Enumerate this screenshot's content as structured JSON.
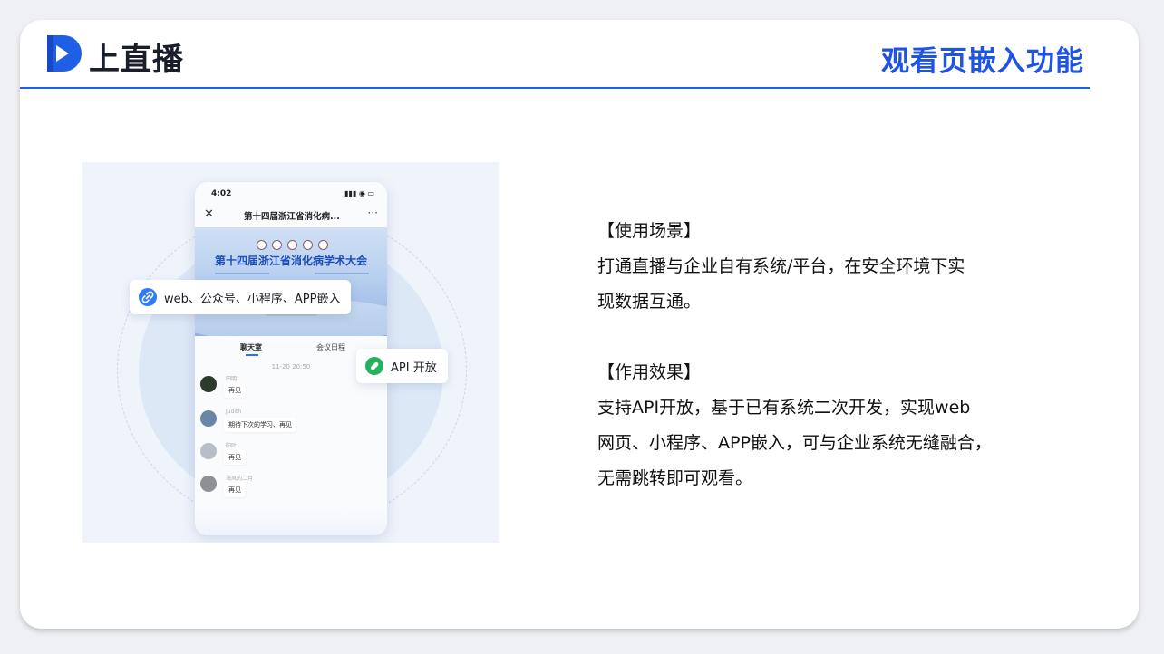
{
  "header": {
    "logo_text": "上直播",
    "page_title": "观看页嵌入功能"
  },
  "colors": {
    "accent": "#1f53e6",
    "rule": "#1f5ee8",
    "pill_blue": "#2f7cf6",
    "pill_green": "#22b35e"
  },
  "phone": {
    "time": "4:02",
    "status_icons": "▮▮▮ ◉ ▭",
    "nav_close": "✕",
    "nav_title": "第十四届浙江省消化病...",
    "nav_more": "···",
    "banner_title": "第十四届浙江省消化病学术大会",
    "tabs": [
      "聊天室",
      "会议日程"
    ],
    "chat_time": "11-20 20:50",
    "messages": [
      {
        "name": "田明",
        "text": "再见"
      },
      {
        "name": "Judith",
        "text": "期待下次的学习、再见"
      },
      {
        "name": "阳叶",
        "text": "再见"
      },
      {
        "name": "海风的二月",
        "text": "再见"
      }
    ]
  },
  "badges": {
    "embed": {
      "icon": "link-icon",
      "text": "web、公众号、小程序、APP嵌入"
    },
    "api": {
      "icon": "capsule-icon",
      "text": "API 开放"
    }
  },
  "info": {
    "scene_heading": "【使用场景】",
    "scene_line1": "打通直播与企业自有系统/平台，在安全环境下实",
    "scene_line2": "现数据互通。",
    "effect_heading": "【作用效果】",
    "effect_line1": "支持API开放，基于已有系统二次开发，实现web",
    "effect_line2": "网页、小程序、APP嵌入，可与企业系统无缝融合，",
    "effect_line3": "无需跳转即可观看。"
  }
}
